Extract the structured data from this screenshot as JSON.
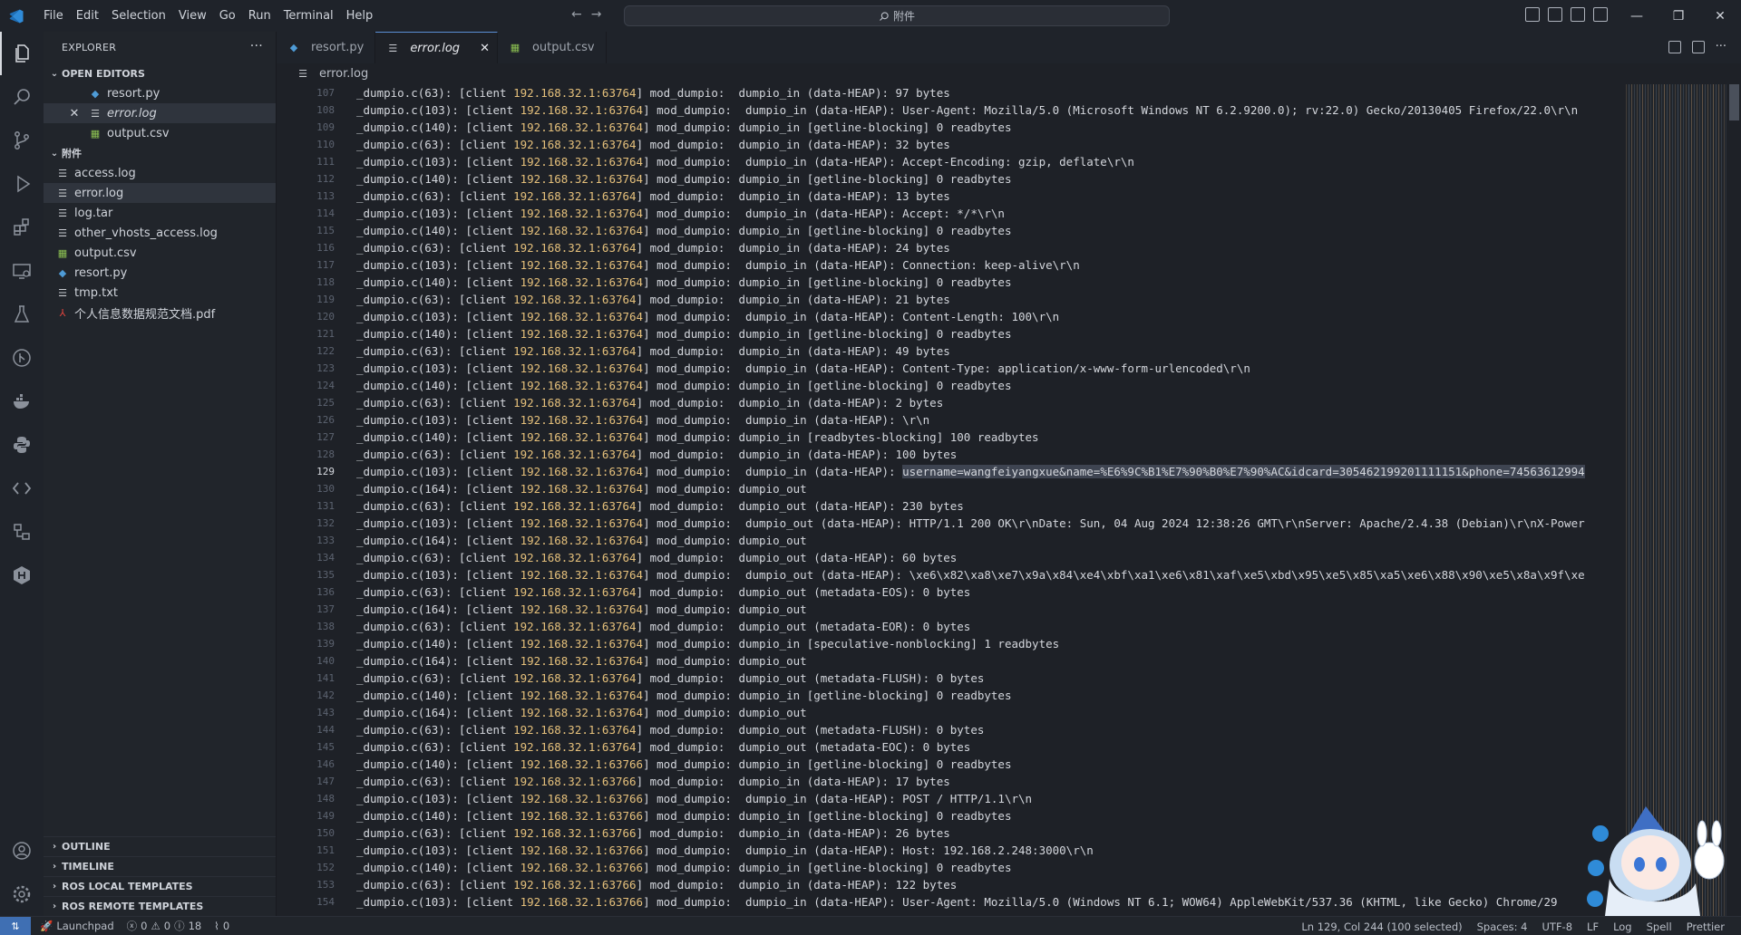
{
  "menu": [
    "File",
    "Edit",
    "Selection",
    "View",
    "Go",
    "Run",
    "Terminal",
    "Help"
  ],
  "command_center": {
    "label": "附件"
  },
  "explorer": {
    "header": "EXPLORER",
    "open_editors_title": "OPEN EDITORS",
    "open_editors": [
      {
        "name": "resort.py",
        "icon": "python-file-icon"
      },
      {
        "name": "error.log",
        "icon": "log-file-icon"
      },
      {
        "name": "output.csv",
        "icon": "csv-file-icon"
      }
    ],
    "folder_title": "附件",
    "files": [
      {
        "name": "access.log",
        "icon": "log-file-icon"
      },
      {
        "name": "error.log",
        "icon": "log-file-icon"
      },
      {
        "name": "log.tar",
        "icon": "archive-file-icon"
      },
      {
        "name": "other_vhosts_access.log",
        "icon": "log-file-icon"
      },
      {
        "name": "output.csv",
        "icon": "csv-file-icon"
      },
      {
        "name": "resort.py",
        "icon": "python-file-icon"
      },
      {
        "name": "tmp.txt",
        "icon": "text-file-icon"
      },
      {
        "name": "个人信息数据规范文档.pdf",
        "icon": "pdf-file-icon"
      }
    ],
    "bottom_sections": [
      "OUTLINE",
      "TIMELINE",
      "ROS LOCAL TEMPLATES",
      "ROS REMOTE TEMPLATES"
    ]
  },
  "tabs": [
    {
      "label": "resort.py",
      "active": false
    },
    {
      "label": "error.log",
      "active": true
    },
    {
      "label": "output.csv",
      "active": false
    }
  ],
  "breadcrumb": "error.log",
  "editor": {
    "current_line": 129,
    "lines": [
      {
        "n": "107",
        "pre": "_dumpio.c(63): [client ",
        "ip": "192.168.32.1:63764",
        "post": "] mod_dumpio:  dumpio_in (data-HEAP): 97 bytes"
      },
      {
        "n": "108",
        "pre": "_dumpio.c(103): [client ",
        "ip": "192.168.32.1:63764",
        "post": "] mod_dumpio:  dumpio_in (data-HEAP): User-Agent: Mozilla/5.0 (Microsoft Windows NT 6.2.9200.0); rv:22.0) Gecko/20130405 Firefox/22.0\\r\\n"
      },
      {
        "n": "109",
        "pre": "_dumpio.c(140): [client ",
        "ip": "192.168.32.1:63764",
        "post": "] mod_dumpio: dumpio_in [getline-blocking] 0 readbytes"
      },
      {
        "n": "110",
        "pre": "_dumpio.c(63): [client ",
        "ip": "192.168.32.1:63764",
        "post": "] mod_dumpio:  dumpio_in (data-HEAP): 32 bytes"
      },
      {
        "n": "111",
        "pre": "_dumpio.c(103): [client ",
        "ip": "192.168.32.1:63764",
        "post": "] mod_dumpio:  dumpio_in (data-HEAP): Accept-Encoding: gzip, deflate\\r\\n"
      },
      {
        "n": "112",
        "pre": "_dumpio.c(140): [client ",
        "ip": "192.168.32.1:63764",
        "post": "] mod_dumpio: dumpio_in [getline-blocking] 0 readbytes"
      },
      {
        "n": "113",
        "pre": "_dumpio.c(63): [client ",
        "ip": "192.168.32.1:63764",
        "post": "] mod_dumpio:  dumpio_in (data-HEAP): 13 bytes"
      },
      {
        "n": "114",
        "pre": "_dumpio.c(103): [client ",
        "ip": "192.168.32.1:63764",
        "post": "] mod_dumpio:  dumpio_in (data-HEAP): Accept: */*\\r\\n"
      },
      {
        "n": "115",
        "pre": "_dumpio.c(140): [client ",
        "ip": "192.168.32.1:63764",
        "post": "] mod_dumpio: dumpio_in [getline-blocking] 0 readbytes"
      },
      {
        "n": "116",
        "pre": "_dumpio.c(63): [client ",
        "ip": "192.168.32.1:63764",
        "post": "] mod_dumpio:  dumpio_in (data-HEAP): 24 bytes"
      },
      {
        "n": "117",
        "pre": "_dumpio.c(103): [client ",
        "ip": "192.168.32.1:63764",
        "post": "] mod_dumpio:  dumpio_in (data-HEAP): Connection: keep-alive\\r\\n"
      },
      {
        "n": "118",
        "pre": "_dumpio.c(140): [client ",
        "ip": "192.168.32.1:63764",
        "post": "] mod_dumpio: dumpio_in [getline-blocking] 0 readbytes"
      },
      {
        "n": "119",
        "pre": "_dumpio.c(63): [client ",
        "ip": "192.168.32.1:63764",
        "post": "] mod_dumpio:  dumpio_in (data-HEAP): 21 bytes"
      },
      {
        "n": "120",
        "pre": "_dumpio.c(103): [client ",
        "ip": "192.168.32.1:63764",
        "post": "] mod_dumpio:  dumpio_in (data-HEAP): Content-Length: 100\\r\\n"
      },
      {
        "n": "121",
        "pre": "_dumpio.c(140): [client ",
        "ip": "192.168.32.1:63764",
        "post": "] mod_dumpio: dumpio_in [getline-blocking] 0 readbytes"
      },
      {
        "n": "122",
        "pre": "_dumpio.c(63): [client ",
        "ip": "192.168.32.1:63764",
        "post": "] mod_dumpio:  dumpio_in (data-HEAP): 49 bytes"
      },
      {
        "n": "123",
        "pre": "_dumpio.c(103): [client ",
        "ip": "192.168.32.1:63764",
        "post": "] mod_dumpio:  dumpio_in (data-HEAP): Content-Type: application/x-www-form-urlencoded\\r\\n"
      },
      {
        "n": "124",
        "pre": "_dumpio.c(140): [client ",
        "ip": "192.168.32.1:63764",
        "post": "] mod_dumpio: dumpio_in [getline-blocking] 0 readbytes"
      },
      {
        "n": "125",
        "pre": "_dumpio.c(63): [client ",
        "ip": "192.168.32.1:63764",
        "post": "] mod_dumpio:  dumpio_in (data-HEAP): 2 bytes"
      },
      {
        "n": "126",
        "pre": "_dumpio.c(103): [client ",
        "ip": "192.168.32.1:63764",
        "post": "] mod_dumpio:  dumpio_in (data-HEAP): \\r\\n"
      },
      {
        "n": "127",
        "pre": "_dumpio.c(140): [client ",
        "ip": "192.168.32.1:63764",
        "post": "] mod_dumpio: dumpio_in [readbytes-blocking] 100 readbytes"
      },
      {
        "n": "128",
        "pre": "_dumpio.c(63): [client ",
        "ip": "192.168.32.1:63764",
        "post": "] mod_dumpio:  dumpio_in (data-HEAP): 100 bytes"
      },
      {
        "n": "129",
        "pre": "_dumpio.c(103): [client ",
        "ip": "192.168.32.1:63764",
        "post": "] mod_dumpio:  dumpio_in (data-HEAP): ",
        "selected": "username=wangfeiyangxue&name=%E6%9C%B1%E7%90%B0%E7%90%AC&idcard=305462199201111151&phone=74563612994"
      },
      {
        "n": "130",
        "pre": "_dumpio.c(164): [client ",
        "ip": "192.168.32.1:63764",
        "post": "] mod_dumpio: dumpio_out"
      },
      {
        "n": "131",
        "pre": "_dumpio.c(63): [client ",
        "ip": "192.168.32.1:63764",
        "post": "] mod_dumpio:  dumpio_out (data-HEAP): 230 bytes"
      },
      {
        "n": "132",
        "pre": "_dumpio.c(103): [client ",
        "ip": "192.168.32.1:63764",
        "post": "] mod_dumpio:  dumpio_out (data-HEAP): HTTP/1.1 200 OK\\r\\nDate: Sun, 04 Aug 2024 12:38:26 GMT\\r\\nServer: Apache/2.4.38 (Debian)\\r\\nX-Power"
      },
      {
        "n": "133",
        "pre": "_dumpio.c(164): [client ",
        "ip": "192.168.32.1:63764",
        "post": "] mod_dumpio: dumpio_out"
      },
      {
        "n": "134",
        "pre": "_dumpio.c(63): [client ",
        "ip": "192.168.32.1:63764",
        "post": "] mod_dumpio:  dumpio_out (data-HEAP): 60 bytes"
      },
      {
        "n": "135",
        "pre": "_dumpio.c(103): [client ",
        "ip": "192.168.32.1:63764",
        "post": "] mod_dumpio:  dumpio_out (data-HEAP): \\xe6\\x82\\xa8\\xe7\\x9a\\x84\\xe4\\xbf\\xa1\\xe6\\x81\\xaf\\xe5\\xbd\\x95\\xe5\\x85\\xa5\\xe6\\x88\\x90\\xe5\\x8a\\x9f\\xe"
      },
      {
        "n": "136",
        "pre": "_dumpio.c(63): [client ",
        "ip": "192.168.32.1:63764",
        "post": "] mod_dumpio:  dumpio_out (metadata-EOS): 0 bytes"
      },
      {
        "n": "137",
        "pre": "_dumpio.c(164): [client ",
        "ip": "192.168.32.1:63764",
        "post": "] mod_dumpio: dumpio_out"
      },
      {
        "n": "138",
        "pre": "_dumpio.c(63): [client ",
        "ip": "192.168.32.1:63764",
        "post": "] mod_dumpio:  dumpio_out (metadata-EOR): 0 bytes"
      },
      {
        "n": "139",
        "pre": "_dumpio.c(140): [client ",
        "ip": "192.168.32.1:63764",
        "post": "] mod_dumpio: dumpio_in [speculative-nonblocking] 1 readbytes"
      },
      {
        "n": "140",
        "pre": "_dumpio.c(164): [client ",
        "ip": "192.168.32.1:63764",
        "post": "] mod_dumpio: dumpio_out"
      },
      {
        "n": "141",
        "pre": "_dumpio.c(63): [client ",
        "ip": "192.168.32.1:63764",
        "post": "] mod_dumpio:  dumpio_out (metadata-FLUSH): 0 bytes"
      },
      {
        "n": "142",
        "pre": "_dumpio.c(140): [client ",
        "ip": "192.168.32.1:63764",
        "post": "] mod_dumpio: dumpio_in [getline-blocking] 0 readbytes"
      },
      {
        "n": "143",
        "pre": "_dumpio.c(164): [client ",
        "ip": "192.168.32.1:63764",
        "post": "] mod_dumpio: dumpio_out"
      },
      {
        "n": "144",
        "pre": "_dumpio.c(63): [client ",
        "ip": "192.168.32.1:63764",
        "post": "] mod_dumpio:  dumpio_out (metadata-FLUSH): 0 bytes"
      },
      {
        "n": "145",
        "pre": "_dumpio.c(63): [client ",
        "ip": "192.168.32.1:63764",
        "post": "] mod_dumpio:  dumpio_out (metadata-EOC): 0 bytes"
      },
      {
        "n": "146",
        "pre": "_dumpio.c(140): [client ",
        "ip": "192.168.32.1:63766",
        "post": "] mod_dumpio: dumpio_in [getline-blocking] 0 readbytes"
      },
      {
        "n": "147",
        "pre": "_dumpio.c(63): [client ",
        "ip": "192.168.32.1:63766",
        "post": "] mod_dumpio:  dumpio_in (data-HEAP): 17 bytes"
      },
      {
        "n": "148",
        "pre": "_dumpio.c(103): [client ",
        "ip": "192.168.32.1:63766",
        "post": "] mod_dumpio:  dumpio_in (data-HEAP): POST / HTTP/1.1\\r\\n"
      },
      {
        "n": "149",
        "pre": "_dumpio.c(140): [client ",
        "ip": "192.168.32.1:63766",
        "post": "] mod_dumpio: dumpio_in [getline-blocking] 0 readbytes"
      },
      {
        "n": "150",
        "pre": "_dumpio.c(63): [client ",
        "ip": "192.168.32.1:63766",
        "post": "] mod_dumpio:  dumpio_in (data-HEAP): 26 bytes"
      },
      {
        "n": "151",
        "pre": "_dumpio.c(103): [client ",
        "ip": "192.168.32.1:63766",
        "post": "] mod_dumpio:  dumpio_in (data-HEAP): Host: 192.168.2.248:3000\\r\\n"
      },
      {
        "n": "152",
        "pre": "_dumpio.c(140): [client ",
        "ip": "192.168.32.1:63766",
        "post": "] mod_dumpio: dumpio_in [getline-blocking] 0 readbytes"
      },
      {
        "n": "153",
        "pre": "_dumpio.c(63): [client ",
        "ip": "192.168.32.1:63766",
        "post": "] mod_dumpio:  dumpio_in (data-HEAP): 122 bytes"
      },
      {
        "n": "154",
        "pre": "_dumpio.c(103): [client ",
        "ip": "192.168.32.1:63766",
        "post": "] mod_dumpio:  dumpio_in (data-HEAP): User-Agent: Mozilla/5.0 (Windows NT 6.1; WOW64) AppleWebKit/537.36 (KHTML, like Gecko) Chrome/29"
      }
    ]
  },
  "statusbar": {
    "launchpad": "Launchpad",
    "errors": "0",
    "warnings": "0",
    "info": "18",
    "ports": "0",
    "position": "Ln 129, Col 244 (100 selected)",
    "spaces": "Spaces: 4",
    "encoding": "UTF-8",
    "eol": "LF",
    "language": "Log",
    "extra": "Spell",
    "extra2": "Prettier"
  }
}
